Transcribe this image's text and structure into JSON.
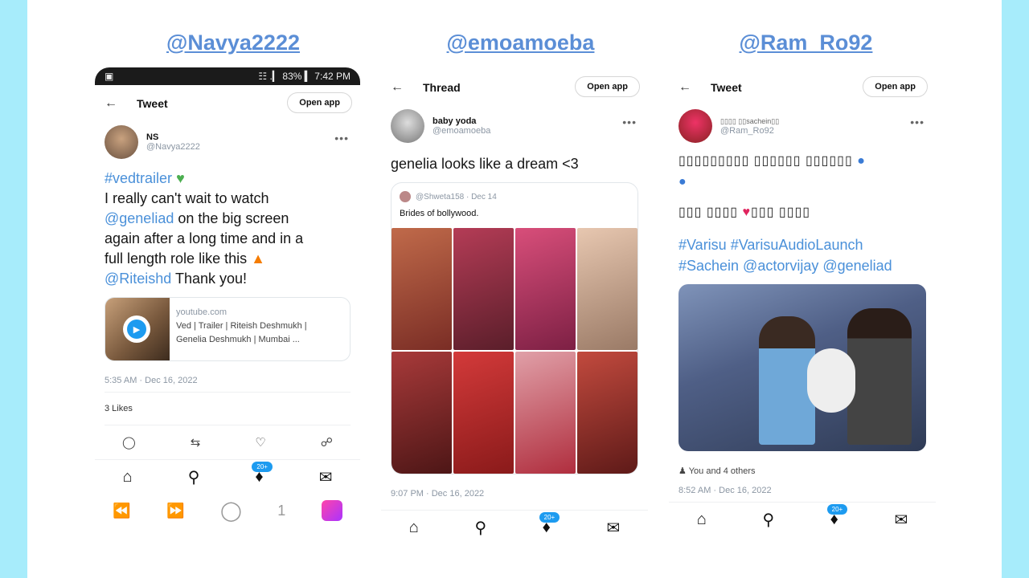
{
  "handles": [
    "@Navya2222",
    "@emoamoeba",
    "@Ram_Ro92"
  ],
  "p1": {
    "status_left": "▣",
    "status_right": "☷ .▎ 83% ▍ 7:42 PM",
    "title": "Tweet",
    "open_app": "Open app",
    "name": "NS",
    "handle": "@Navya2222",
    "hashtag": "#vedtrailer",
    "line1": "I really can't wait to watch",
    "mention1": "@geneliad",
    "line2": " on the big screen",
    "line3": "again after a long time and in a",
    "line4": "full length role like this",
    "mention2": "@Riteishd",
    "line5": " Thank you!",
    "card_domain": "youtube.com",
    "card_title1": "Ved | Trailer | Riteish Deshmukh |",
    "card_title2": "Genelia Deshmukh | Mumbai ...",
    "timestamp": "5:35 AM · Dec 16, 2022",
    "likes": "3 Likes",
    "badge": "20+"
  },
  "p2": {
    "title": "Thread",
    "open_app": "Open app",
    "name": "baby yoda",
    "handle": "@emoamoeba",
    "text": "genelia looks like a dream <3",
    "quote_handle": "@Shweta158 · Dec 14",
    "quote_text": "Brides of bollywood.",
    "timestamp": "9:07 PM · Dec 16, 2022",
    "badge": "20+"
  },
  "p3": {
    "title": "Tweet",
    "open_app": "Open app",
    "name": "▯▯▯▯ ▯▯sachein▯▯",
    "handle": "@Ram_Ro92",
    "line1": "▯▯▯▯▯▯▯▯▯ ▯▯▯▯▯▯ ▯▯▯▯▯▯",
    "line2": "▯▯▯ ▯▯▯▯",
    "line2b": "▯▯▯ ▯▯▯▯",
    "hash1": "#Varisu #VarisuAudioLaunch",
    "hash2": "#Sachein @actorvijay @geneliad",
    "liked_by": "You and 4 others",
    "timestamp": "8:52 AM · Dec 16, 2022",
    "badge": "20+"
  },
  "sysnav": {
    "page": "1"
  }
}
